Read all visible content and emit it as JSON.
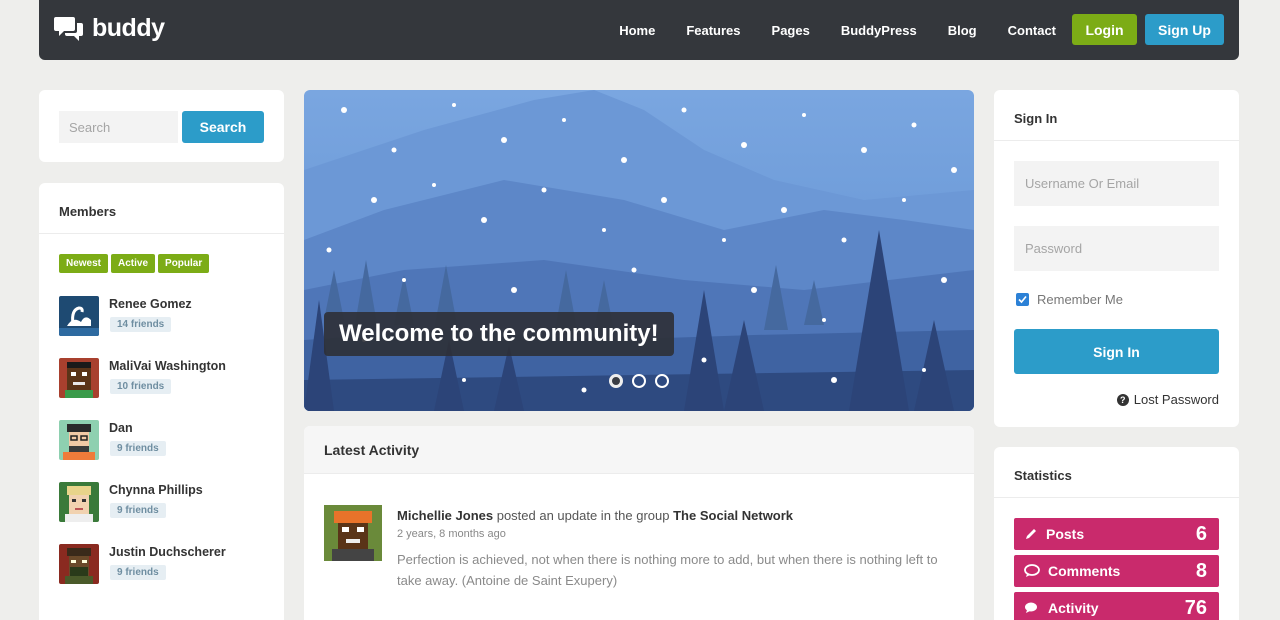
{
  "brand": {
    "name": "buddy"
  },
  "nav": {
    "items": [
      "Home",
      "Features",
      "Pages",
      "BuddyPress",
      "Blog",
      "Contact"
    ],
    "login": "Login",
    "signup": "Sign Up"
  },
  "search": {
    "placeholder": "Search",
    "button": "Search"
  },
  "members": {
    "title": "Members",
    "filters": [
      "Newest",
      "Active",
      "Popular"
    ],
    "list": [
      {
        "name": "Renee Gomez",
        "friends": "14 friends"
      },
      {
        "name": "MaliVai Washington",
        "friends": "10 friends"
      },
      {
        "name": "Dan",
        "friends": "9 friends"
      },
      {
        "name": "Chynna Phillips",
        "friends": "9 friends"
      },
      {
        "name": "Justin Duchscherer",
        "friends": "9 friends"
      }
    ]
  },
  "hero": {
    "caption": "Welcome to the community!",
    "slides": 3,
    "active_slide": 1
  },
  "activity": {
    "title": "Latest Activity",
    "item": {
      "user": "Michellie Jones",
      "action": "posted an update in the group",
      "group": "The Social Network",
      "time": "2 years, 8 months ago",
      "text": "Perfection is achieved, not when there is nothing more to add, but when there is nothing left to take away. (Antoine de Saint Exupery)"
    }
  },
  "signin": {
    "title": "Sign In",
    "username_placeholder": "Username Or Email",
    "password_placeholder": "Password",
    "remember": "Remember Me",
    "remember_checked": true,
    "button": "Sign In",
    "lost": "Lost Password"
  },
  "stats": {
    "title": "Statistics",
    "items": [
      {
        "label": "Posts",
        "count": "6",
        "icon": "pencil-icon"
      },
      {
        "label": "Comments",
        "count": "8",
        "icon": "speech-bubble-icon"
      },
      {
        "label": "Activity",
        "count": "76",
        "icon": "chat-bubbles-icon"
      }
    ]
  },
  "colors": {
    "accent_blue": "#2c9cc9",
    "accent_green": "#7cac16",
    "stat_pink": "#c92a6c",
    "topbar": "#34373c"
  }
}
